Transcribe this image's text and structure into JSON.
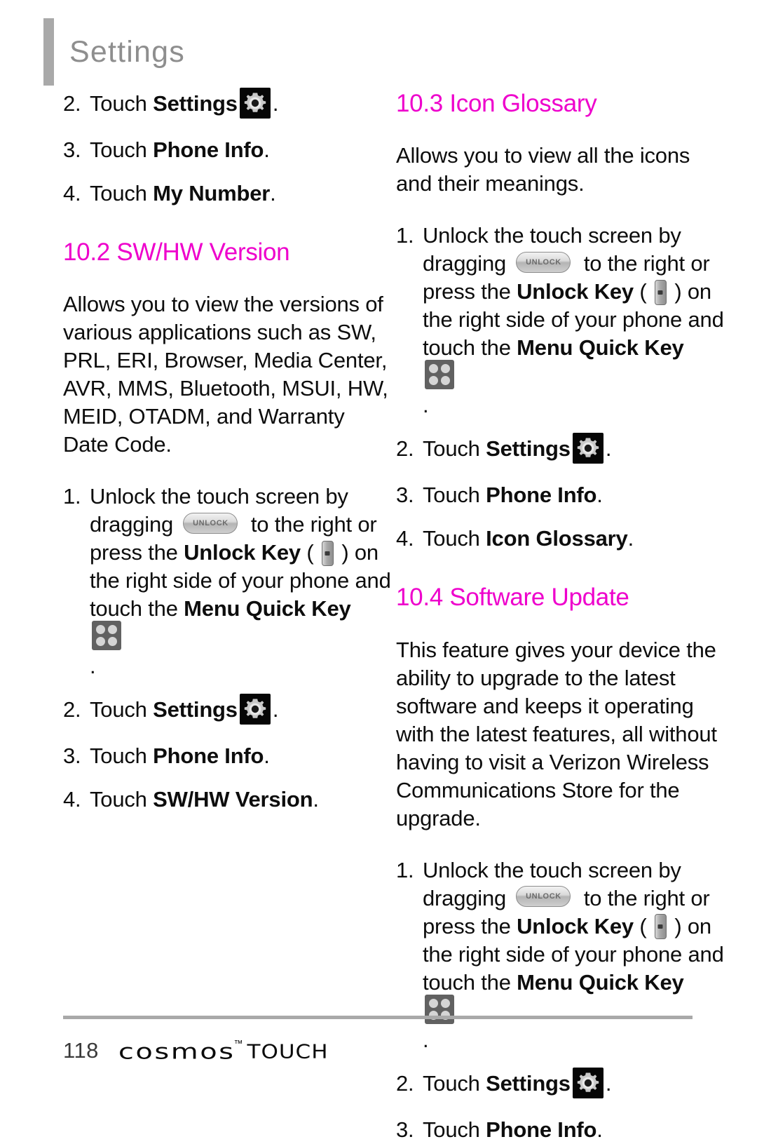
{
  "header": {
    "title": "Settings"
  },
  "icons": {
    "settings": "settings-gear-icon",
    "unlock_slider": "unlock-slider-icon",
    "unlock_slider_label": "UNLOCK",
    "unlock_key": "unlock-key-icon",
    "menu_quick_key": "menu-quick-key-icon"
  },
  "colors": {
    "heading_magenta": "#ee00cc",
    "header_gray": "#a9a9a9",
    "title_gray": "#8e8e8e",
    "body_black": "#0d0d0d"
  },
  "left_column": {
    "continued_steps": [
      {
        "num": "2.",
        "pre": "Touch ",
        "bold": "Settings",
        "icon": "settings",
        "post": "."
      },
      {
        "num": "3.",
        "pre": "Touch ",
        "bold": "Phone Info",
        "post": "."
      },
      {
        "num": "4.",
        "pre": "Touch ",
        "bold": "My Number",
        "post": "."
      }
    ],
    "section": {
      "heading": "10.2 SW/HW Version",
      "paragraph": "Allows you to view the versions of various applications such as SW, PRL, ERI, Browser, Media Center, AVR, MMS, Bluetooth, MSUI, HW, MEID, OTADM, and Warranty Date Code.",
      "steps": [
        {
          "num": "1.",
          "text_1": "Unlock the touch screen by dragging ",
          "text_2": " to the right or press the ",
          "bold_1": "Unlock Key",
          "text_3": " ( ",
          "text_4": " ) on the right side of your phone and touch the ",
          "bold_2": "Menu Quick Key",
          "text_5": " ."
        },
        {
          "num": "2.",
          "pre": "Touch ",
          "bold": "Settings",
          "icon": "settings",
          "post": "."
        },
        {
          "num": "3.",
          "pre": "Touch ",
          "bold": "Phone Info",
          "post": "."
        },
        {
          "num": "4.",
          "pre": "Touch ",
          "bold": "SW/HW Version",
          "post": "."
        }
      ]
    }
  },
  "right_column": {
    "section_icon_glossary": {
      "heading": "10.3 Icon Glossary",
      "paragraph": "Allows you to view all the icons and their meanings.",
      "steps": [
        {
          "num": "1.",
          "text_1": "Unlock the touch screen by dragging ",
          "text_2": " to the right or press the ",
          "bold_1": "Unlock Key",
          "text_3": " ( ",
          "text_4": " ) on the right side of your phone and touch the ",
          "bold_2": "Menu Quick Key",
          "text_5": " ."
        },
        {
          "num": "2.",
          "pre": "Touch ",
          "bold": "Settings",
          "icon": "settings",
          "post": "."
        },
        {
          "num": "3.",
          "pre": "Touch ",
          "bold": "Phone Info",
          "post": "."
        },
        {
          "num": "4.",
          "pre": "Touch ",
          "bold": "Icon Glossary",
          "post": "."
        }
      ]
    },
    "section_software_update": {
      "heading": "10.4 Software Update",
      "paragraph": "This feature gives your device the ability to upgrade to the latest software and keeps it operating with the latest features, all without having to visit a Verizon Wireless Communications Store for the upgrade.",
      "steps": [
        {
          "num": "1.",
          "text_1": "Unlock the touch screen by dragging ",
          "text_2": " to the right or press the ",
          "bold_1": "Unlock Key",
          "text_3": " ( ",
          "text_4": " ) on the right side of your phone and touch the ",
          "bold_2": "Menu Quick Key",
          "text_5": " ."
        },
        {
          "num": "2.",
          "pre": "Touch ",
          "bold": "Settings",
          "icon": "settings",
          "post": "."
        },
        {
          "num": "3.",
          "pre": "Touch ",
          "bold": "Phone Info",
          "post": "."
        }
      ]
    }
  },
  "footer": {
    "page_number": "118",
    "brand_name": "cosmos",
    "brand_tm": "™",
    "brand_suffix": "TOUCH"
  }
}
